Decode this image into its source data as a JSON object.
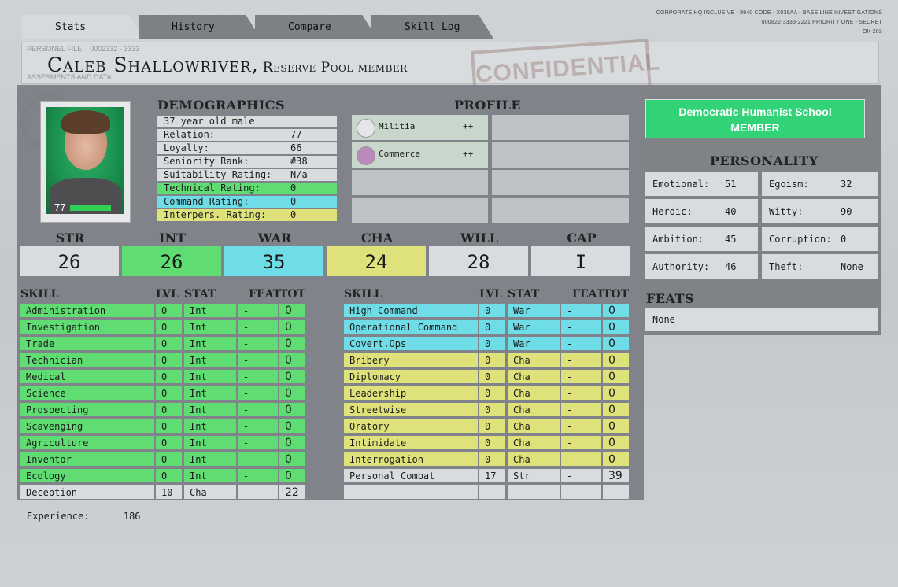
{
  "tabs": [
    {
      "label": "Stats",
      "active": true
    },
    {
      "label": "History",
      "active": false
    },
    {
      "label": "Compare",
      "active": false
    },
    {
      "label": "Skill Log",
      "active": false
    }
  ],
  "header_meta": [
    "CORPORATE HQ INCLUSIVE - 9940 CODE - X039AA - BASE LINE INVESTIGATIONS",
    "000822-3333-2221 PRIORITY ONE - SECRET",
    "OK 202"
  ],
  "file": {
    "label": "PERSONEL FILE",
    "number": "0002332 - 3333",
    "sub": "ASSESMENTS AND DATA",
    "name": "Caleb Shallowriver",
    "comma": ",",
    "role": "Reserve Pool member",
    "stamp": "CONFIDENTIAL"
  },
  "portrait": {
    "health": "77",
    "health_fraction": 0.77
  },
  "demographics": {
    "title": "DEMOGRAPHICS",
    "rows": [
      {
        "label": "37 year old male",
        "value": ""
      },
      {
        "label": "Relation:",
        "value": "77"
      },
      {
        "label": "Loyalty:",
        "value": "66"
      },
      {
        "label": "Seniority Rank:",
        "value": "#38"
      },
      {
        "label": "Suitability Rating:",
        "value": "N/a"
      },
      {
        "label": "Technical Rating:",
        "value": "0"
      },
      {
        "label": "Command Rating:",
        "value": "0"
      },
      {
        "label": "Interpers. Rating:",
        "value": "0"
      }
    ]
  },
  "profile": {
    "title": "PROFILE",
    "items": [
      {
        "label": "Militia",
        "rating": "++",
        "icon": "fist-icon"
      },
      {
        "label": "Commerce",
        "rating": "++",
        "icon": "coins-icon"
      }
    ]
  },
  "attributes": [
    {
      "name": "STR",
      "value": "26"
    },
    {
      "name": "INT",
      "value": "26"
    },
    {
      "name": "WAR",
      "value": "35"
    },
    {
      "name": "CHA",
      "value": "24"
    },
    {
      "name": "WILL",
      "value": "28"
    },
    {
      "name": "CAP",
      "value": "I"
    }
  ],
  "skill_headers": {
    "skill": "SKILL",
    "lvl": "LVL",
    "stat": "STAT",
    "feat": "FEAT",
    "tot": "TOT"
  },
  "skills_left": [
    {
      "name": "Administration",
      "lvl": "0",
      "stat": "Int",
      "feat": "-",
      "tot": "0",
      "color": "green"
    },
    {
      "name": "Investigation",
      "lvl": "0",
      "stat": "Int",
      "feat": "-",
      "tot": "0",
      "color": "green"
    },
    {
      "name": "Trade",
      "lvl": "0",
      "stat": "Int",
      "feat": "-",
      "tot": "0",
      "color": "green"
    },
    {
      "name": "Technician",
      "lvl": "0",
      "stat": "Int",
      "feat": "-",
      "tot": "0",
      "color": "green"
    },
    {
      "name": "Medical",
      "lvl": "0",
      "stat": "Int",
      "feat": "-",
      "tot": "0",
      "color": "green"
    },
    {
      "name": "Science",
      "lvl": "0",
      "stat": "Int",
      "feat": "-",
      "tot": "0",
      "color": "green"
    },
    {
      "name": "Prospecting",
      "lvl": "0",
      "stat": "Int",
      "feat": "-",
      "tot": "0",
      "color": "green"
    },
    {
      "name": "Scavenging",
      "lvl": "0",
      "stat": "Int",
      "feat": "-",
      "tot": "0",
      "color": "green"
    },
    {
      "name": "Agriculture",
      "lvl": "0",
      "stat": "Int",
      "feat": "-",
      "tot": "0",
      "color": "green"
    },
    {
      "name": "Inventor",
      "lvl": "0",
      "stat": "Int",
      "feat": "-",
      "tot": "0",
      "color": "green"
    },
    {
      "name": "Ecology",
      "lvl": "0",
      "stat": "Int",
      "feat": "-",
      "tot": "0",
      "color": "green"
    },
    {
      "name": "Deception",
      "lvl": "10",
      "stat": "Cha",
      "feat": "-",
      "tot": "22",
      "color": "grey"
    }
  ],
  "skills_right": [
    {
      "name": "High Command",
      "lvl": "0",
      "stat": "War",
      "feat": "-",
      "tot": "0",
      "color": "cyan"
    },
    {
      "name": "Operational Command",
      "lvl": "0",
      "stat": "War",
      "feat": "-",
      "tot": "0",
      "color": "cyan"
    },
    {
      "name": "Covert.Ops",
      "lvl": "0",
      "stat": "War",
      "feat": "-",
      "tot": "0",
      "color": "cyan"
    },
    {
      "name": "Bribery",
      "lvl": "0",
      "stat": "Cha",
      "feat": "-",
      "tot": "0",
      "color": "yellow"
    },
    {
      "name": "Diplomacy",
      "lvl": "0",
      "stat": "Cha",
      "feat": "-",
      "tot": "0",
      "color": "yellow"
    },
    {
      "name": "Leadership",
      "lvl": "0",
      "stat": "Cha",
      "feat": "-",
      "tot": "0",
      "color": "yellow"
    },
    {
      "name": "Streetwise",
      "lvl": "0",
      "stat": "Cha",
      "feat": "-",
      "tot": "0",
      "color": "yellow"
    },
    {
      "name": "Oratory",
      "lvl": "0",
      "stat": "Cha",
      "feat": "-",
      "tot": "0",
      "color": "yellow"
    },
    {
      "name": "Intimidate",
      "lvl": "0",
      "stat": "Cha",
      "feat": "-",
      "tot": "0",
      "color": "yellow"
    },
    {
      "name": "Interrogation",
      "lvl": "0",
      "stat": "Cha",
      "feat": "-",
      "tot": "0",
      "color": "yellow"
    },
    {
      "name": "Personal Combat",
      "lvl": "17",
      "stat": "Str",
      "feat": "-",
      "tot": "39",
      "color": "grey"
    },
    {
      "name": "",
      "lvl": "",
      "stat": "",
      "feat": "",
      "tot": "",
      "color": "grey"
    }
  ],
  "political": {
    "line1": "Democratic Humanist School",
    "line2": "MEMBER"
  },
  "personality": {
    "title": "PERSONALITY",
    "items": [
      {
        "label": "Emotional:",
        "value": "51"
      },
      {
        "label": "Egoism:",
        "value": "32"
      },
      {
        "label": "Heroic:",
        "value": "40"
      },
      {
        "label": "Witty:",
        "value": "90"
      },
      {
        "label": "Ambition:",
        "value": "45"
      },
      {
        "label": "Corruption:",
        "value": "0"
      },
      {
        "label": "Authority:",
        "value": "46"
      },
      {
        "label": "Theft:",
        "value": "None"
      }
    ]
  },
  "feats": {
    "title": "FEATS",
    "value": "None"
  },
  "experience": {
    "label": "Experience:",
    "value": "186"
  },
  "colors": {
    "green": "#5fdc72",
    "cyan": "#6fdde8",
    "yellow": "#dfe27a",
    "grey": "#d9dcde",
    "party": "#32d377"
  }
}
